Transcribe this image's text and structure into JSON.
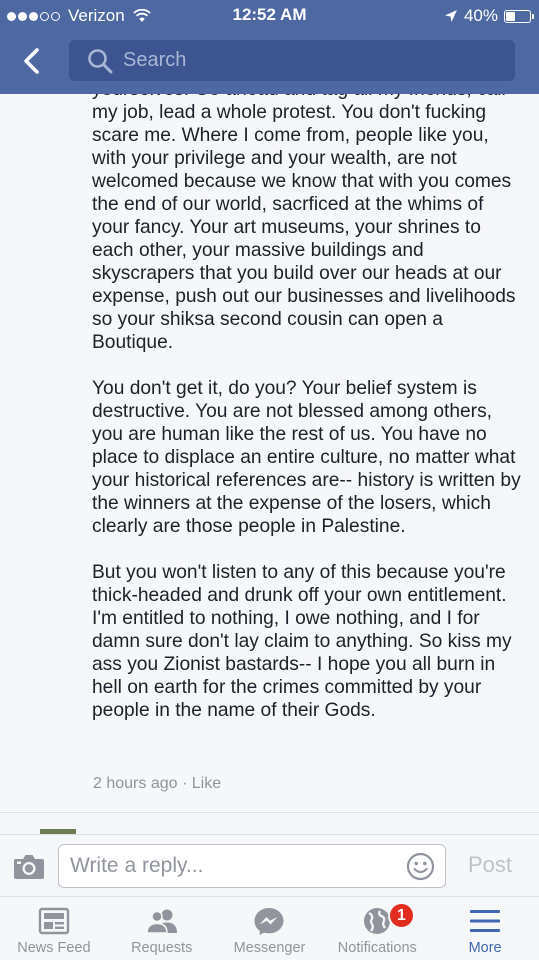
{
  "status_bar": {
    "carrier": "Verizon",
    "time": "12:52 AM",
    "battery": "40%",
    "battery_level": 0.4
  },
  "header": {
    "search_placeholder": "Search"
  },
  "comment": {
    "paragraphs": [
      "yourselves. Go ahead and tag all my friends, call my job, lead a whole protest. You don't fucking scare me. Where I come from, people like you, with your privilege and your wealth, are not welcomed because we know that with you comes the end of our world, sacrficed at the whims of your fancy. Your art museums, your shrines to each other, your massive buildings and skyscrapers that you build over our heads at our expense, push out our businesses and livelihoods so your shiksa second cousin can open a Boutique.",
      "You don't get it, do you? Your belief system is destructive. You are not blessed among others, you are human like the rest of us. You have no place to displace an entire culture, no matter what your historical references are-- history is written by the winners at the expense of the losers, which clearly are those people in Palestine.",
      "But you won't listen to any of this because you're thick-headed and drunk off your own entitlement. I'm entitled to nothing, I owe nothing, and I for damn sure don't lay claim to anything. So kiss my ass you Zionist bastards-- I hope you all burn in hell on earth for the crimes committed by your people in the name of their Gods."
    ],
    "time_ago": "2 hours ago",
    "separator": "·",
    "like_label": "Like"
  },
  "composer": {
    "placeholder": "Write a reply...",
    "post_label": "Post"
  },
  "tabs": [
    {
      "label": "News Feed",
      "icon": "news-feed-icon"
    },
    {
      "label": "Requests",
      "icon": "friend-requests-icon"
    },
    {
      "label": "Messenger",
      "icon": "messenger-icon"
    },
    {
      "label": "Notifications",
      "icon": "globe-icon",
      "badge": "1"
    },
    {
      "label": "More",
      "icon": "menu-icon",
      "active": true
    }
  ],
  "colors": {
    "header_bg": "#4e69a2",
    "accent": "#4267b2",
    "badge": "#e02d20",
    "muted_text": "#90949c"
  }
}
